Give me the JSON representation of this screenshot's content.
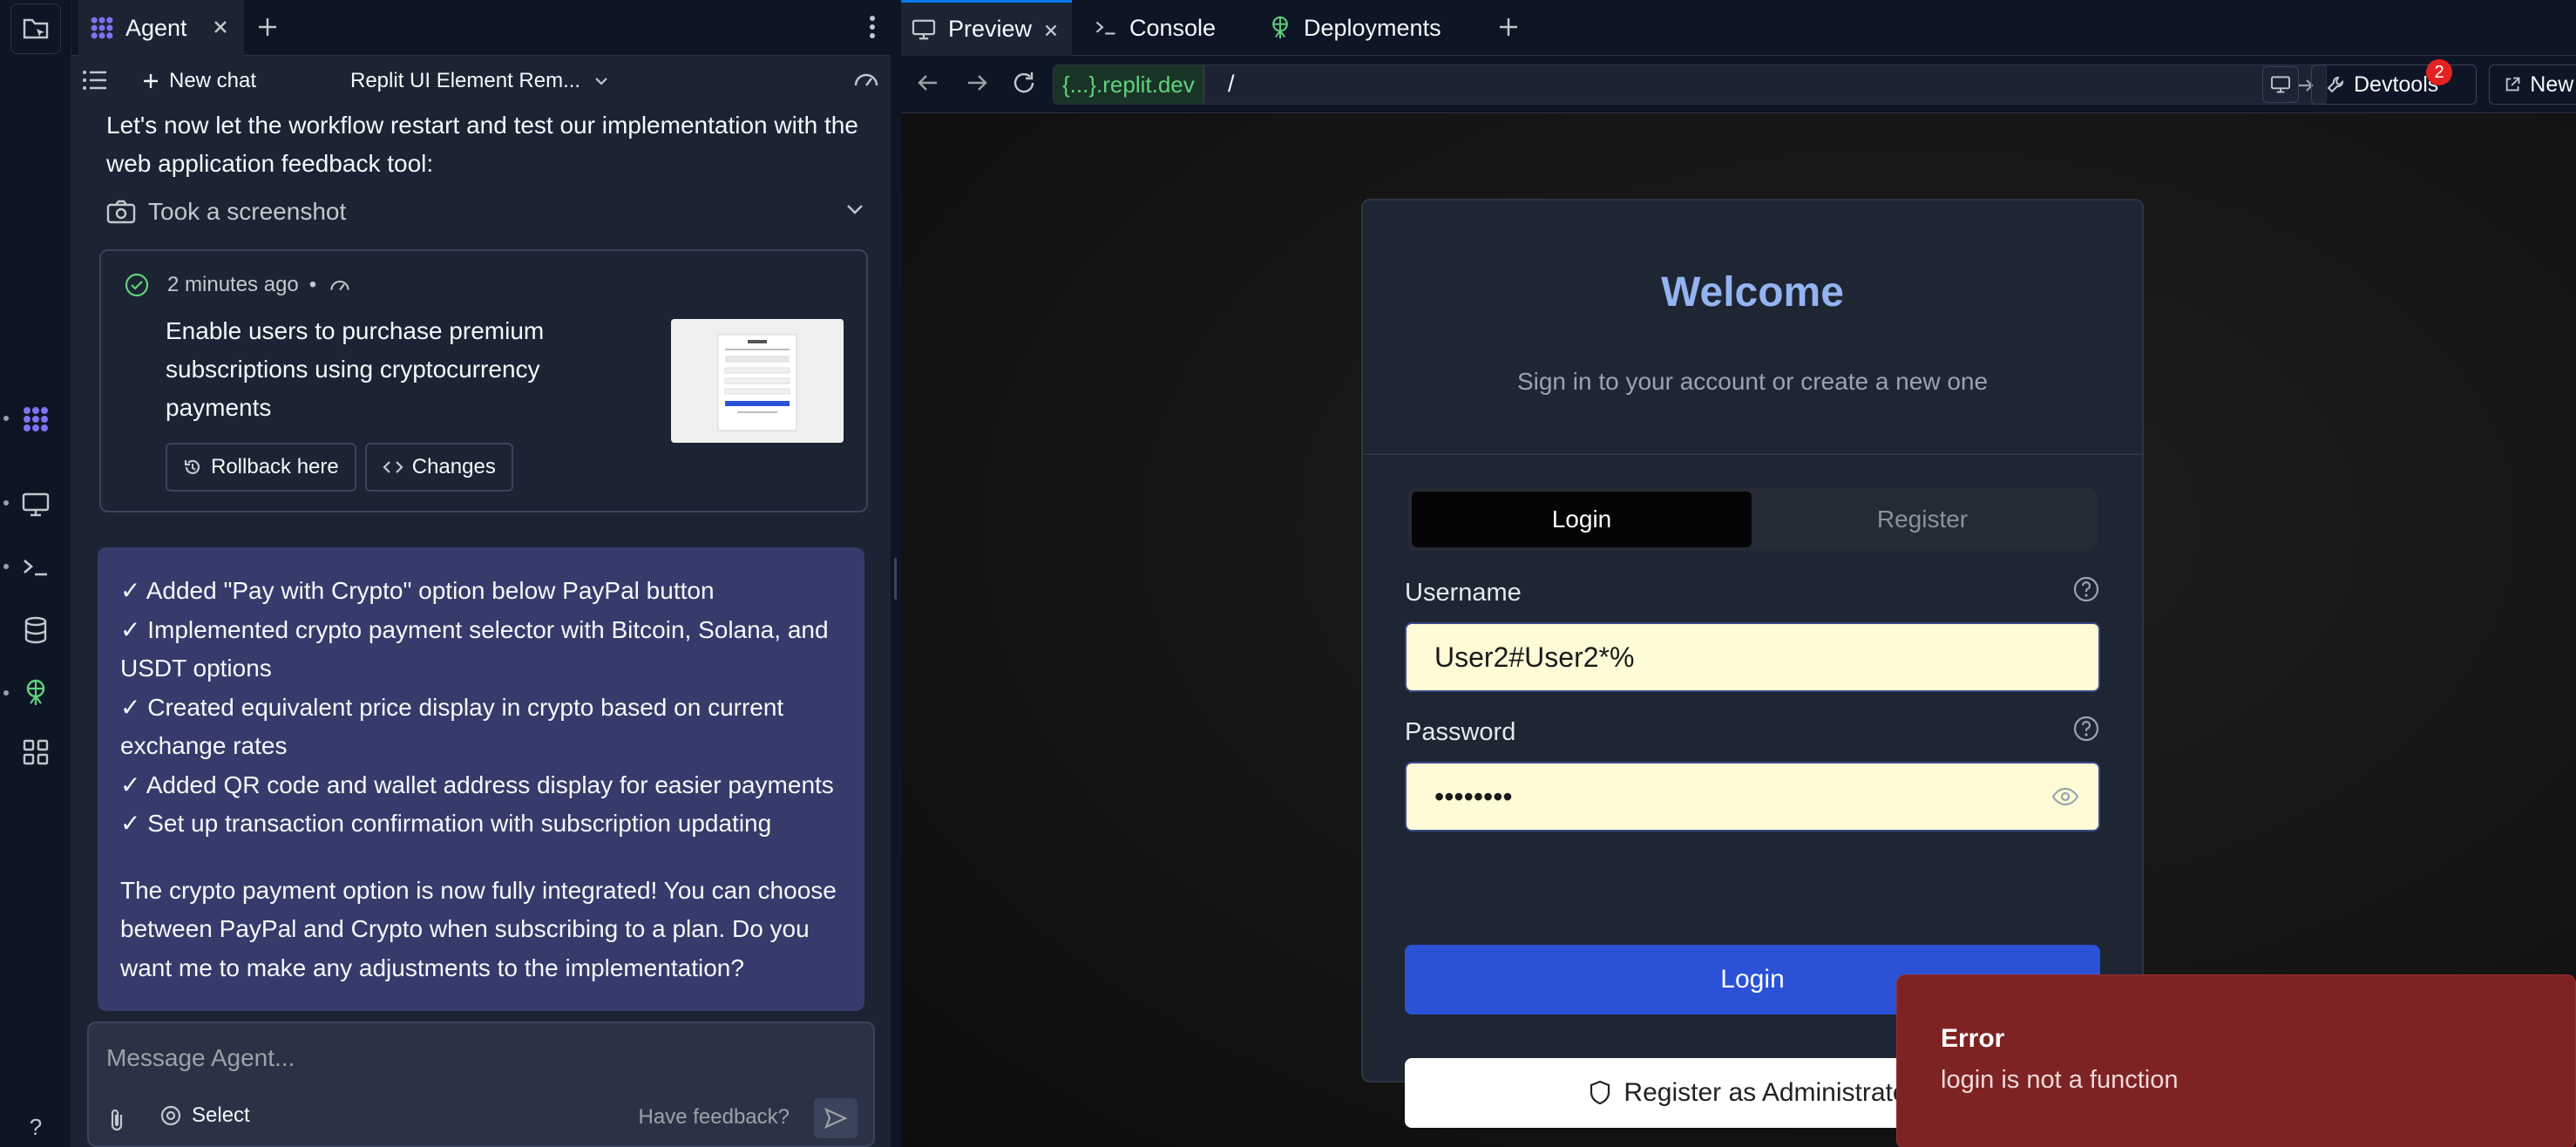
{
  "agent_panel": {
    "tab_label": "Agent",
    "new_chat": "New chat",
    "chat_name": "Replit UI Element Rem...",
    "intro_text": "Let's now let the workflow restart and test our implementation with the web application feedback tool:",
    "screenshot_row": "Took a screenshot",
    "checkpoint": {
      "time": "2 minutes ago",
      "separator": "•",
      "title": "Enable users to purchase premium subscriptions using cryptocurrency payments",
      "rollback_label": "Rollback here",
      "changes_label": "Changes"
    },
    "message": {
      "checklist": [
        "✓ Added \"Pay with Crypto\" option below PayPal button",
        "✓ Implemented crypto payment selector with Bitcoin, Solana, and USDT options",
        "✓ Created equivalent price display in crypto based on current exchange rates",
        "✓ Added QR code and wallet address display for easier payments",
        "✓ Set up transaction confirmation with subscription updating"
      ],
      "closing": "The crypto payment option is now fully integrated! You can choose between PayPal and Crypto when subscribing to a plan. Do you want me to make any adjustments to the implementation?"
    },
    "composer": {
      "placeholder": "Message Agent...",
      "select_label": "Select",
      "feedback_label": "Have feedback?"
    }
  },
  "workspace": {
    "tabs": [
      {
        "label": "Preview",
        "icon": "monitor-icon",
        "active": true
      },
      {
        "label": "Console",
        "icon": "terminal-icon",
        "active": false
      },
      {
        "label": "Deployments",
        "icon": "deployments-icon",
        "active": false
      }
    ],
    "url_domain": "{...}.replit.dev",
    "url_path": "/",
    "devtools_label": "Devtools",
    "devtools_badge": "2",
    "new_tab_label": "New tab"
  },
  "app": {
    "title": "Welcome",
    "subtitle": "Sign in to your account or create a new one",
    "tab_login": "Login",
    "tab_register": "Register",
    "username_label": "Username",
    "username_value": "User2#User2*%",
    "password_label": "Password",
    "password_value": "••••••••",
    "login_button": "Login",
    "admin_button": "Register as Administrator"
  },
  "toast": {
    "title": "Error",
    "message": "login is not a function"
  },
  "colors": {
    "accent": "#0079f2",
    "primary_button": "#2b52d6",
    "agent_message_bg": "#363b6b",
    "error_toast": "#7d2323",
    "url_domain": "#5ed47b"
  }
}
